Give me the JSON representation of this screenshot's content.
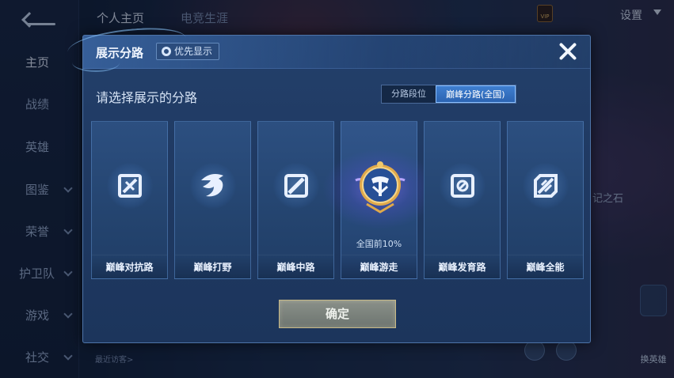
{
  "background": {
    "top_tabs": [
      "个人主页",
      "电竞生涯"
    ],
    "settings_label": "设置",
    "sidebar_items": [
      {
        "label": "主页",
        "has_chevron": false
      },
      {
        "label": "战绩",
        "has_chevron": false
      },
      {
        "label": "英雄",
        "has_chevron": false
      },
      {
        "label": "图鉴",
        "has_chevron": true
      },
      {
        "label": "荣誉",
        "has_chevron": true
      },
      {
        "label": "护卫队",
        "has_chevron": true
      },
      {
        "label": "游戏",
        "has_chevron": true
      },
      {
        "label": "社交",
        "has_chevron": true
      }
    ],
    "recent_visitors_label": "最近访客>",
    "right_partial_text": "记之石",
    "switch_hero_label": "换英雄",
    "vip_label": "VIP"
  },
  "modal": {
    "title": "展示分路",
    "priority_button_label": "优先显示",
    "prompt": "请选择展示的分路",
    "segment_tabs": [
      {
        "label": "分路段位",
        "active": false
      },
      {
        "label": "巅峰分路(全国)",
        "active": true
      }
    ],
    "cards": [
      {
        "label": "巅峰对抗路",
        "icon": "sword-lane-icon",
        "highlight": false,
        "rank_text": ""
      },
      {
        "label": "巅峰打野",
        "icon": "dragon-jungle-icon",
        "highlight": false,
        "rank_text": ""
      },
      {
        "label": "巅峰中路",
        "icon": "mid-lane-icon",
        "highlight": false,
        "rank_text": ""
      },
      {
        "label": "巅峰游走",
        "icon": "roam-medal-icon",
        "highlight": true,
        "rank_text": "全国前10%"
      },
      {
        "label": "巅峰发育路",
        "icon": "marksman-lane-icon",
        "highlight": false,
        "rank_text": ""
      },
      {
        "label": "巅峰全能",
        "icon": "all-round-icon",
        "highlight": false,
        "rank_text": ""
      }
    ],
    "confirm_label": "确定"
  },
  "colors": {
    "accent": "#3f7fd0",
    "modal_bg": "#203a63",
    "medal_gold": "#e0a94a",
    "glow": "#8c6eff"
  }
}
